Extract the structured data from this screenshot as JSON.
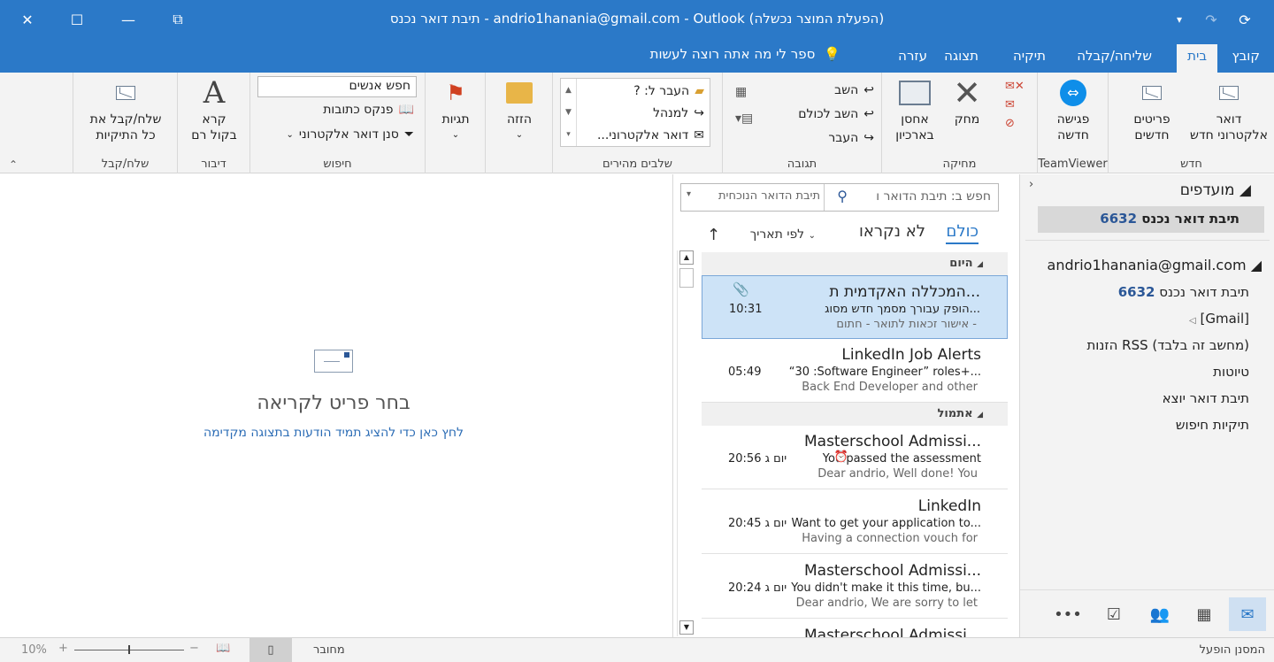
{
  "titlebar": {
    "title": "תיבת דואר נכנס - andrio1hanania@gmail.com - Outlook (הפעלת המוצר נכשלה)"
  },
  "tabs": [
    {
      "label": "קובץ"
    },
    {
      "label": "בית"
    },
    {
      "label": "שליחה/קבלה"
    },
    {
      "label": "תיקיה"
    },
    {
      "label": "תצוגה"
    },
    {
      "label": "עזרה"
    }
  ],
  "tell_me": "ספר לי מה אתה רוצה לעשות",
  "ribbon": {
    "new": {
      "label": "חדש",
      "new_email": [
        "דואר",
        "אלקטרוני חדש"
      ],
      "new_items": [
        "פריטים",
        "חדשים"
      ]
    },
    "teamviewer": {
      "label": "TeamViewer",
      "new_meeting": [
        "פגישה",
        "חדשה"
      ]
    },
    "delete": {
      "label": "מחיקה",
      "delete_btn": "מחק",
      "archive_btn": [
        "אחסן",
        "בארכיון"
      ]
    },
    "respond": {
      "label": "תגובה",
      "reply": "השב",
      "reply_all": "השב לכולם",
      "forward": "העבר"
    },
    "quick_steps": {
      "label": "שלבים מהירים",
      "items": [
        "העבר ל: ?",
        "למנהל",
        "דואר אלקטרוני..."
      ]
    },
    "move": {
      "label": "הזזה"
    },
    "tags": {
      "label": "תגיות"
    },
    "find": {
      "label": "חיפוש",
      "search_people_placeholder": "חפש אנשים",
      "address_book": "פנקס כתובות",
      "filter_email": "סנן דואר אלקטרוני"
    },
    "speech": {
      "label": "דיבור",
      "read_aloud": [
        "קרא",
        "בקול רם"
      ]
    },
    "send_receive": {
      "label": "שלח/קבל",
      "send_all": [
        "שלח/קבל את",
        "כל התיקיות"
      ]
    }
  },
  "nav": {
    "favorites": "מועדפים",
    "fav_inbox": "תיבת דואר נכנס",
    "fav_inbox_count": "6632",
    "account": "andrio1hanania@gmail.com",
    "folders": [
      {
        "name": "תיבת דואר נכנס",
        "count": "6632"
      },
      {
        "name": "[Gmail]",
        "count": ""
      },
      {
        "name": "הזנות RSS (מחשב זה בלבד)",
        "count": ""
      },
      {
        "name": "טיוטות",
        "count": ""
      },
      {
        "name": "תיבת דואר יוצא",
        "count": ""
      },
      {
        "name": "תיקיות חיפוש",
        "count": ""
      }
    ]
  },
  "maillist": {
    "search_placeholder": "חפש ב: תיבת הדואר ו",
    "scope": "תיבת הדואר הנוכחית",
    "filter_all": "כולם",
    "filter_unread": "לא נקראו",
    "sort_by": "לפי תאריך",
    "groups": [
      {
        "label": "היום"
      },
      {
        "label": "אתמול"
      }
    ],
    "mails": [
      {
        "sender": "המכללה האקדמית ת...",
        "subject": "הופק עבורך מסמך חדש מסוג...",
        "preview": "אישור זכאות לתואר - חתום -",
        "time": "10:31"
      },
      {
        "sender": "LinkedIn Job Alerts",
        "subject": "“30 :Software Engineer” roles+...",
        "preview": "Back End Developer and other",
        "time": "05:49"
      },
      {
        "sender": "Masterschool Admissi...",
        "subject": "You passed the assessment",
        "preview": "Dear andrio,  Well done! You",
        "time": "יום ג 20:56"
      },
      {
        "sender": "LinkedIn",
        "subject": "Want to get your application to...",
        "preview": "Having a connection vouch for",
        "time": "יום ג 20:45"
      },
      {
        "sender": "Masterschool Admissi...",
        "subject": "You didn't make it this time, bu...",
        "preview": "Dear andrio,  We are sorry to let",
        "time": "יום ג 20:24"
      },
      {
        "sender": "Masterschool Admissi...",
        "subject": "",
        "preview": "",
        "time": ""
      }
    ]
  },
  "reading": {
    "title": "בחר פריט לקריאה",
    "link": "לחץ כאן כדי להציג תמיד הודעות בתצוגה מקדימה"
  },
  "status": {
    "filter": "המסנן הופעל",
    "connection": "מחובר",
    "zoom": "10%"
  }
}
